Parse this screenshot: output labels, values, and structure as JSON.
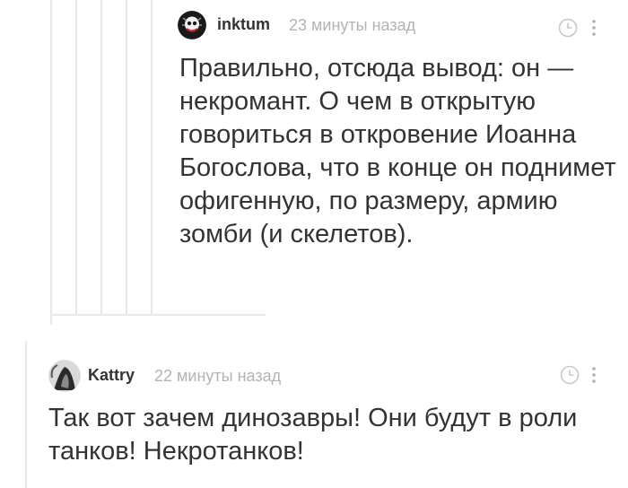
{
  "comments": [
    {
      "username": "inktum",
      "time": "23 минуты назад",
      "avatar_icon": "skull-avatar-icon",
      "text": "Правильно, отсюда вывод: он — некромант. О чем в открытую говориться в откровение Иоанна Богослова, что в конце он поднимет офигенную, по размеру, армию зомби (и скелетов)."
    },
    {
      "username": "Kattry",
      "time": "22 минуты назад",
      "avatar_icon": "portrait-avatar-icon",
      "text": "Так вот зачем динозавры! Они будут в роли танков! Некротанков!"
    }
  ],
  "colors": {
    "text": "#333333",
    "meta": "#b3b3b3",
    "thread_line": "#e8e8e8",
    "icon": "#c8c8c8"
  }
}
